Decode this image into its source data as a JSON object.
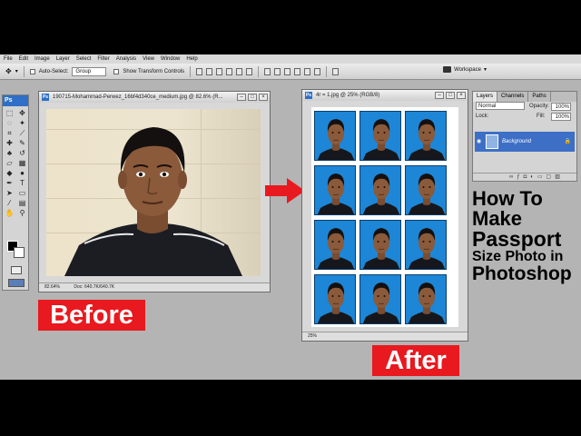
{
  "menu": [
    "File",
    "Edit",
    "Image",
    "Layer",
    "Select",
    "Filter",
    "Analysis",
    "View",
    "Window",
    "Help"
  ],
  "options": {
    "auto_select_label": "Auto-Select:",
    "auto_select_value": "Group",
    "transform_label": "Show Transform Controls",
    "workspace_label": "Workspace"
  },
  "tools": {
    "ps_label": "Ps"
  },
  "before_window": {
    "title": "190715-Mohammad-Perwez_16bf4d340ce_medium.jpg @ 82.6% (R...",
    "zoom": "82.64%",
    "doc": "Doc: 640.7K/640.7K"
  },
  "after_window": {
    "title": "4r = 1.jpg @ 25% (RGB/8)",
    "zoom": "25%"
  },
  "layers_panel": {
    "tabs": [
      "Layers",
      "Channels",
      "Paths"
    ],
    "blend_mode": "Normal",
    "opacity_label": "Opacity:",
    "opacity_value": "100%",
    "lock_label": "Lock:",
    "fill_label": "Fill:",
    "fill_value": "100%",
    "layer_name": "Background"
  },
  "captions": {
    "before": "Before",
    "after": "After",
    "headline": [
      "How To",
      "Make",
      "Passport",
      "Size Photo in",
      "Photoshop"
    ]
  },
  "colors": {
    "caption_red": "#e8191f",
    "passport_blue": "#1d86d6",
    "arrow_red": "#e8191f"
  }
}
